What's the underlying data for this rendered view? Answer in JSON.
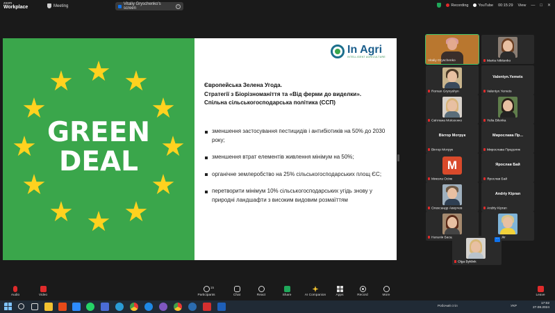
{
  "app": {
    "brand_small": "zoom",
    "brand_name": "Workplace",
    "meeting_label": "Meeting"
  },
  "screen_share": {
    "label": "Vitaliy Gryschenko's screen"
  },
  "status": {
    "recording": "Recording",
    "youtube": "YouTube",
    "timer": "00:15:29",
    "view": "View"
  },
  "window_controls": {
    "minimize": "—",
    "restore": "□",
    "close": "✕"
  },
  "slide": {
    "green_line1": "GREEN",
    "green_line2": "DEAL",
    "brand_name": "In Agri",
    "brand_tagline": "INTELLIGENT AGRICULTURE",
    "heading_line1": "Європейська Зелена Угода.",
    "heading_line2": "Стратегії з Біорізноманіття та «Від ферми до виделки».",
    "heading_line3": "Спільна сільськогосподарська політика (ССП)",
    "bullets": [
      "зменшення застосування пестицидів і антибіотиків на 50% до 2030 року;",
      "зменшення втрат елементів живлення мінімум на 50%;",
      "органічне землеробство на 25% сільськогосподарських площ ЄС;",
      "перетворити мінімум 10% сільськогосподарських угідь знову у природні ландшафти з високим видовим розмаїттям"
    ]
  },
  "participants": [
    {
      "name": "Vitaliy Gryschenko",
      "type": "video"
    },
    {
      "name": "Mariia Nikitenko",
      "type": "video"
    },
    {
      "name": "Roman Grynyshyn",
      "type": "video"
    },
    {
      "name": "Valentyn.Yemets",
      "center": "Valentyn.Yemets",
      "type": "name"
    },
    {
      "name": "Світлана Моісеєнко",
      "type": "video"
    },
    {
      "name": "Yulia Bilenka",
      "type": "video"
    },
    {
      "name": "Віктор Мотрук",
      "center": "Віктор Мотрук",
      "type": "name"
    },
    {
      "name": "Мирослава Предоляк",
      "center": "Мирослава Пр...",
      "type": "name"
    },
    {
      "name": "Микола Осіяк",
      "avatar_letter": "M",
      "type": "avatar"
    },
    {
      "name": "Ярослав Бай",
      "center": "Ярослав Бай",
      "type": "name"
    },
    {
      "name": "Олександр Аверчев",
      "type": "video"
    },
    {
      "name": "Andriy Kipran",
      "center": "Andriy Kipran",
      "type": "name"
    },
    {
      "name": "Наталія Басаленко",
      "type": "video"
    },
    {
      "name": "IryanaKhUkr",
      "type": "video"
    },
    {
      "name": "Olga Byklink",
      "type": "video"
    }
  ],
  "toolbar": {
    "audio": "Audio",
    "video": "Video",
    "participants": "Participants",
    "participants_count": "15",
    "chat": "Chat",
    "react": "React",
    "share": "Share",
    "ai": "AI Companion",
    "apps": "Apps",
    "record": "Record",
    "more": "More",
    "leave": "Leave"
  },
  "taskbar": {
    "workspace": "Робочий стіл",
    "lang": "УКР",
    "time": "17:02",
    "date": "27.08.2024"
  },
  "colors": {
    "slide_green": "#3aa64b",
    "star_yellow": "#ffd21f",
    "recording_red": "#e02b2b",
    "accent_blue": "#0e72ed"
  }
}
